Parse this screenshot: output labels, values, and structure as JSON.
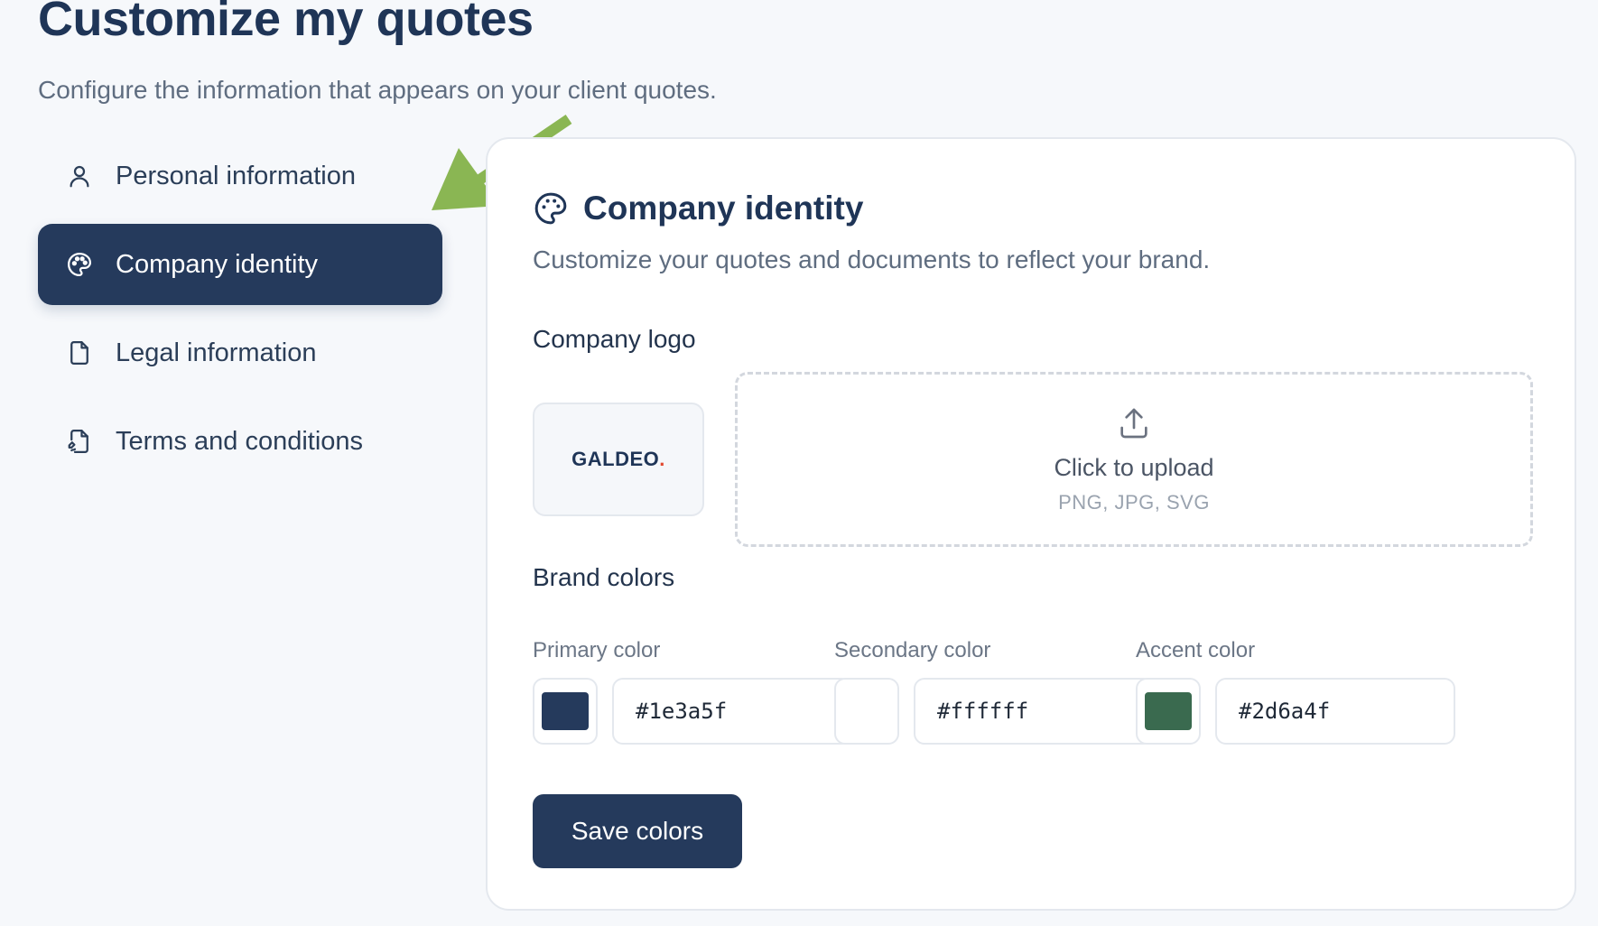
{
  "page": {
    "title": "Customize my quotes",
    "subtitle": "Configure the information that appears on your client quotes."
  },
  "sidebar": {
    "items": [
      {
        "label": "Personal information",
        "icon": "user-icon",
        "active": false
      },
      {
        "label": "Company identity",
        "icon": "palette-icon",
        "active": true
      },
      {
        "label": "Legal information",
        "icon": "file-icon",
        "active": false
      },
      {
        "label": "Terms and conditions",
        "icon": "file-signature-icon",
        "active": false
      }
    ]
  },
  "annotation": {
    "icon": "green-arrow-icon",
    "color": "#8ab653"
  },
  "card": {
    "icon": "palette-icon",
    "title": "Company identity",
    "description": "Customize your quotes and documents to reflect your brand.",
    "logo": {
      "label": "Company logo",
      "preview_brand": "GALDEO",
      "preview_dot": ".",
      "upload_icon": "upload-icon",
      "upload_text": "Click to upload",
      "upload_hint": "PNG, JPG, SVG"
    },
    "colors": {
      "label": "Brand colors",
      "items": [
        {
          "label": "Primary color",
          "value": "#1e3a5f"
        },
        {
          "label": "Secondary color",
          "value": "#ffffff"
        },
        {
          "label": "Accent color",
          "value": "#2d6a4f"
        }
      ]
    },
    "save_label": "Save colors"
  },
  "theme": {
    "brand_navy": "#253a5c",
    "logo_dot_color": "#e2482f"
  }
}
